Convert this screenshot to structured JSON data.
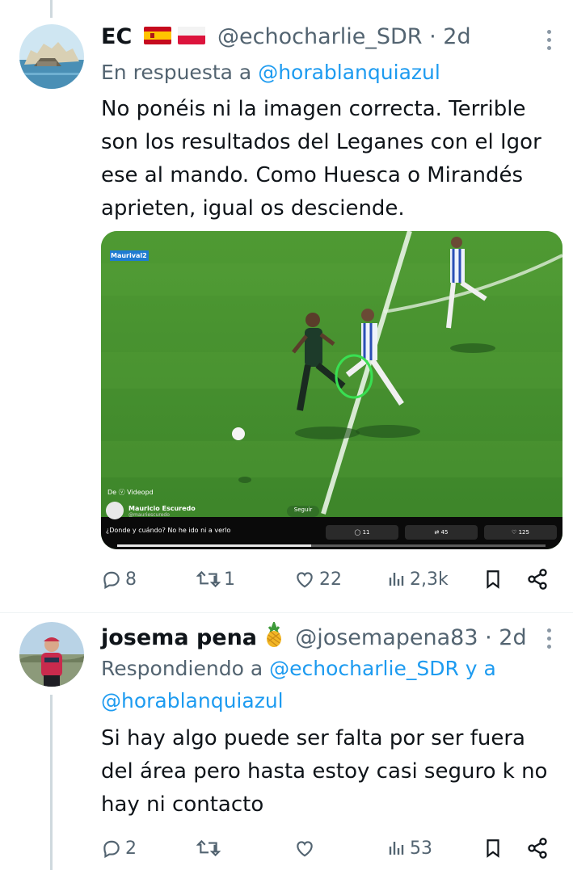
{
  "tweets": [
    {
      "author_name": "EC",
      "flags": [
        "spain-flag",
        "poland-flag"
      ],
      "handle": "@echocharlie_SDR",
      "separator": " · ",
      "time": "2d",
      "reply_prefix": "En respuesta a ",
      "reply_handles": "@horablanquiazul",
      "text": "No ponéis ni la imagen correcta. Terrible son los resultados del Leganes con el Igor ese al mando. Como Huesca o Mirandés aprieten, igual os desciende.",
      "stats": {
        "replies": "8",
        "retweets": "1",
        "likes": "22",
        "views": "2,3k"
      }
    },
    {
      "author_name": "josema pena",
      "emoji": "pineapple-emoji",
      "handle": "@josemapena83",
      "separator": " · ",
      "time": "2d",
      "reply_prefix": "Respondiendo a ",
      "reply_handles": "@echocharlie_SDR",
      "reply_joiner": " y a",
      "reply_handles_2": "@horablanquiazul",
      "text": "Si hay algo puede ser falta por ser fuera del área pero hasta estoy casi seguro k no hay ni contacto",
      "stats": {
        "replies": "2",
        "retweets": "",
        "likes": "",
        "views": "53"
      }
    }
  ],
  "video": {
    "channel_tag": "Maurival2",
    "source_label": "De ⓥ Videopd",
    "poster_name": "Mauricio Escuredo",
    "poster_handle": "@mauriescuredo",
    "follow_label": "Seguir",
    "caption": "¿Donde y cuándo? No he ido ni a verlo",
    "overlay_replies": "11",
    "overlay_retweets": "45",
    "overlay_likes": "125"
  },
  "colors": {
    "link": "#1d9bf0",
    "secondary_text": "#536471",
    "pitch_green": "#3f8a2e",
    "highlight_circle": "#39e052"
  }
}
